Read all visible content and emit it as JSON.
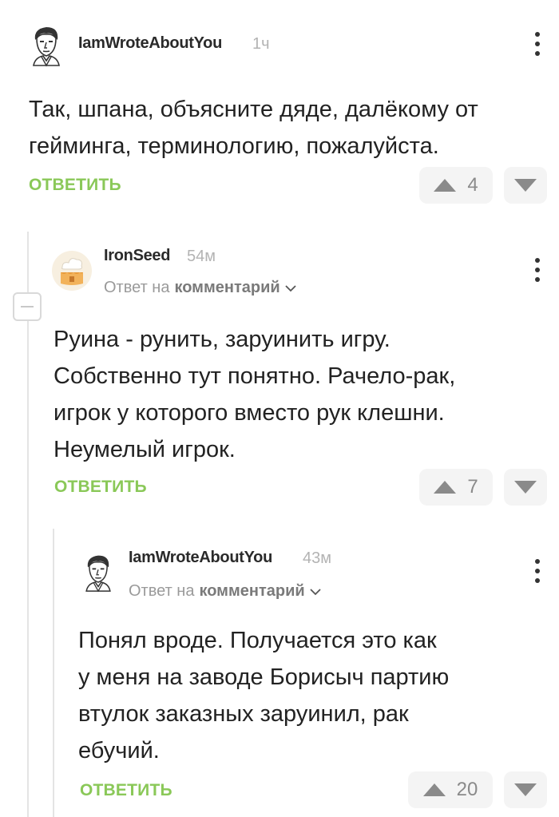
{
  "comments": [
    {
      "username": "IamWroteAboutYou",
      "time": "1ч",
      "lines": [
        "Так, шпана, объясните дяде, далёкому от",
        "гейминга, терминологию, пожалуйста."
      ],
      "reply_label": "ОТВЕТИТЬ",
      "votes": "4"
    },
    {
      "username": "IronSeed",
      "time": "54м",
      "reply_to_prefix": "Ответ на",
      "reply_to_link": "комментарий",
      "lines": [
        "Руина - рунить, заруинить игру.",
        "Собственно тут понятно. Рачело-рак,",
        "игрок у которого вместо рук клешни.",
        "Неумелый игрок."
      ],
      "reply_label": "ОТВЕТИТЬ",
      "votes": "7"
    },
    {
      "username": "IamWroteAboutYou",
      "time": "43м",
      "reply_to_prefix": "Ответ на",
      "reply_to_link": "комментарий",
      "lines": [
        "Понял вроде. Получается это как",
        "у меня на заводе Борисыч партию",
        "втулок заказных заруинил, рак",
        "ебучий."
      ],
      "reply_label": "ОТВЕТИТЬ",
      "votes": "20"
    }
  ],
  "icons": {
    "avatar_1": "man-portrait-avatar",
    "avatar_2": "cake-avatar",
    "upvote": "triangle-up-icon",
    "downvote": "triangle-down-icon",
    "more": "vertical-dots-icon",
    "collapse": "minus-icon",
    "chevron": "chevron-down-icon"
  },
  "colors": {
    "reply_green": "#8ac858",
    "vote_bg": "#f4f4f4",
    "muted": "#b3b3b3"
  }
}
